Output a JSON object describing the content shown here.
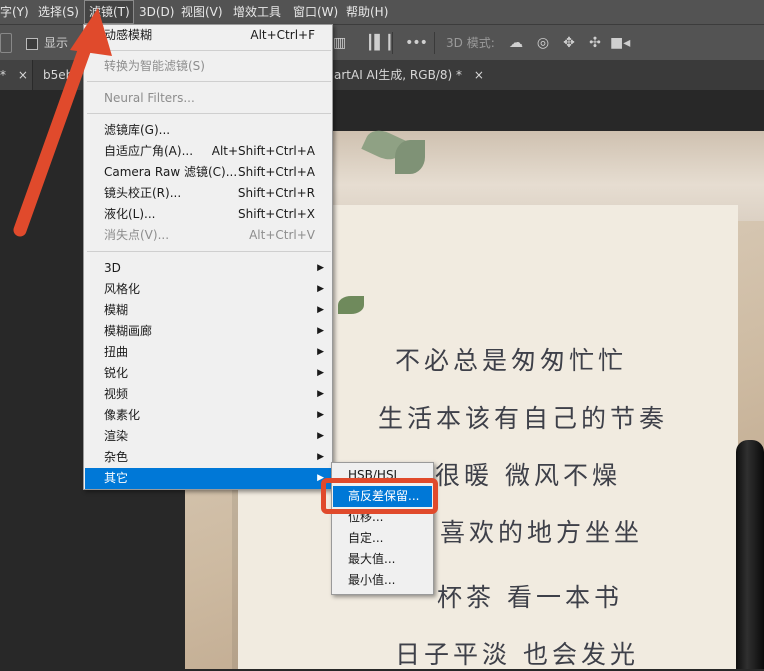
{
  "menubar": {
    "items": [
      {
        "label": "字(Y)"
      },
      {
        "label": "选择(S)"
      },
      {
        "label": "滤镜(T)"
      },
      {
        "label": "3D(D)"
      },
      {
        "label": "视图(V)"
      },
      {
        "label": "增效工具"
      },
      {
        "label": "窗口(W)"
      },
      {
        "label": "帮助(H)"
      }
    ]
  },
  "options_bar": {
    "show_label": "显示",
    "mode_3d_label": "3D 模式:",
    "more_label": "•••"
  },
  "tabs": [
    {
      "label": "*",
      "close": "×"
    },
    {
      "label": "b5eb",
      "close": ""
    },
    {
      "label": "artAI AI生成, RGB/8) *",
      "close": "×"
    }
  ],
  "filter_menu": {
    "top_items": [
      {
        "label": "动感模糊",
        "shortcut": "Alt+Ctrl+F",
        "disabled": false
      }
    ],
    "convert_item": {
      "label": "转换为智能滤镜(S)",
      "disabled": true
    },
    "neural_item": {
      "label": "Neural Filters...",
      "disabled": true
    },
    "tool_items": [
      {
        "label": "滤镜库(G)...",
        "shortcut": "",
        "disabled": false
      },
      {
        "label": "自适应广角(A)...",
        "shortcut": "Alt+Shift+Ctrl+A",
        "disabled": false
      },
      {
        "label": "Camera Raw 滤镜(C)...",
        "shortcut": "Shift+Ctrl+A",
        "disabled": false
      },
      {
        "label": "镜头校正(R)...",
        "shortcut": "Shift+Ctrl+R",
        "disabled": false
      },
      {
        "label": "液化(L)...",
        "shortcut": "Shift+Ctrl+X",
        "disabled": false
      },
      {
        "label": "消失点(V)...",
        "shortcut": "Alt+Ctrl+V",
        "disabled": true
      }
    ],
    "submenu_items": [
      {
        "label": "3D"
      },
      {
        "label": "风格化"
      },
      {
        "label": "模糊"
      },
      {
        "label": "模糊画廊"
      },
      {
        "label": "扭曲"
      },
      {
        "label": "锐化"
      },
      {
        "label": "视频"
      },
      {
        "label": "像素化"
      },
      {
        "label": "渲染"
      },
      {
        "label": "杂色"
      },
      {
        "label": "其它"
      }
    ]
  },
  "other_submenu": {
    "items": [
      {
        "label": "HSB/HSL"
      },
      {
        "label": "高反差保留..."
      },
      {
        "label": "位移..."
      },
      {
        "label": "自定..."
      },
      {
        "label": "最大值..."
      },
      {
        "label": "最小值..."
      }
    ]
  },
  "canvas": {
    "poem_lines": [
      "不必总是匆匆忙忙",
      "生活本该有自己的节奏",
      "很暖   微风不燥",
      "喜欢的地方坐坐",
      "杯茶   看一本书",
      "日子平淡   也会发光"
    ]
  },
  "colors": {
    "highlight": "#0078d7",
    "callout": "#e04a2c"
  }
}
